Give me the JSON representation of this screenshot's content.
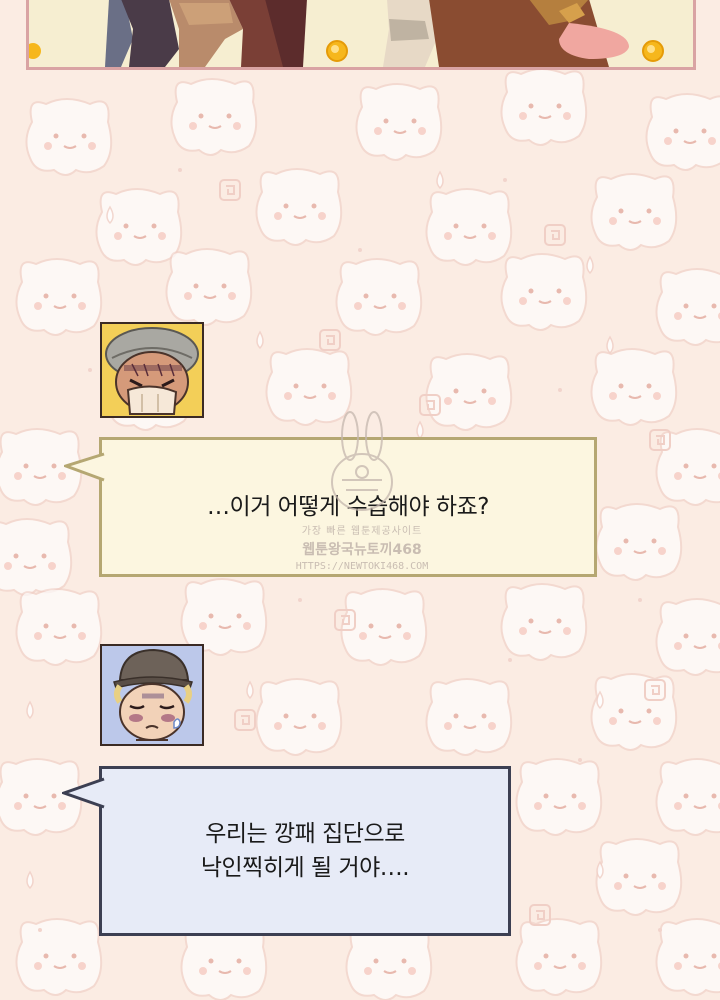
{
  "colors": {
    "background": "#fbece3",
    "pattern_cat": "#f6dcd3",
    "panel_border": "#d9a3a3",
    "bubble1_fill": "#fcf6e0",
    "bubble1_border": "#b5a772",
    "bubble2_fill": "#e7ebf7",
    "bubble2_border": "#3c3f52",
    "avatar1_bg": "#f3cf58",
    "avatar2_bg": "#bcc8ea"
  },
  "dialogue": [
    {
      "speaker_icon": "grey-cap-character-icon",
      "text": "…이거 어떻게 수습해야 하죠?"
    },
    {
      "speaker_icon": "flat-cap-character-icon",
      "text_lines": [
        "우리는 깡패 집단으로",
        "낙인찍히게 될 거야…."
      ]
    }
  ],
  "watermark": {
    "line1": "가장 빠른 웹툰제공사이트",
    "line2": "웹툰왕국뉴토끼468",
    "line3": "HTTPS://NEWTOKI468.COM"
  }
}
